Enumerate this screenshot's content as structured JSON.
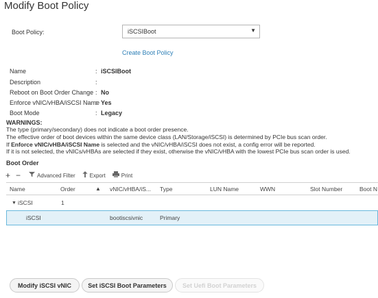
{
  "page_title": "Modify Boot Policy",
  "boot_policy": {
    "label": "Boot Policy:",
    "selected": "iSCSIBoot",
    "arrow": "▼",
    "create_link": "Create Boot Policy"
  },
  "properties": [
    {
      "key": "Name",
      "value": "iSCSIBoot"
    },
    {
      "key": "Description",
      "value": ""
    },
    {
      "key": "Reboot on Boot Order Change",
      "value": "No"
    },
    {
      "key": "Enforce vNIC/vHBA/iSCSI Name",
      "value": "Yes"
    },
    {
      "key": "Boot Mode",
      "value": "Legacy"
    }
  ],
  "warnings": {
    "heading": "WARNINGS:",
    "line1": "The type (primary/secondary) does not indicate a boot order presence.",
    "line2": "The effective order of boot devices within the same device class (LAN/Storage/iSCSI) is determined by PCIe bus scan order.",
    "line3_prefix": "If ",
    "line3_bold": "Enforce vNIC/vHBA/iSCSI Name",
    "line3_suffix": " is selected and the vNIC/vHBA/iSCSI does not exist, a config error will be reported.",
    "line4": "If it is not selected, the vNICs/vHBAs are selected if they exist, otherwise the vNIC/vHBA with the lowest PCIe bus scan order is used."
  },
  "boot_order": {
    "heading": "Boot Order",
    "toolbar": {
      "add": "+",
      "remove": "−",
      "filter": "Advanced Filter",
      "export": "Export",
      "print": "Print"
    },
    "columns": [
      "Name",
      "Order",
      "vNIC/vHBA/iS...",
      "Type",
      "LUN Name",
      "WWN",
      "Slot Number",
      "Boot N"
    ],
    "sort_indicator": "▲",
    "rows": [
      {
        "name": "iSCSI",
        "order": "1",
        "vnic": "",
        "type": ""
      },
      {
        "name": "iSCSI",
        "order": "",
        "vnic": "bootiscsivnic",
        "type": "Primary"
      }
    ]
  },
  "buttons": {
    "modify_vnic": "Modify iSCSI vNIC",
    "set_params": "Set iSCSI Boot Parameters",
    "set_uefi": "Set Uefi Boot Parameters"
  }
}
